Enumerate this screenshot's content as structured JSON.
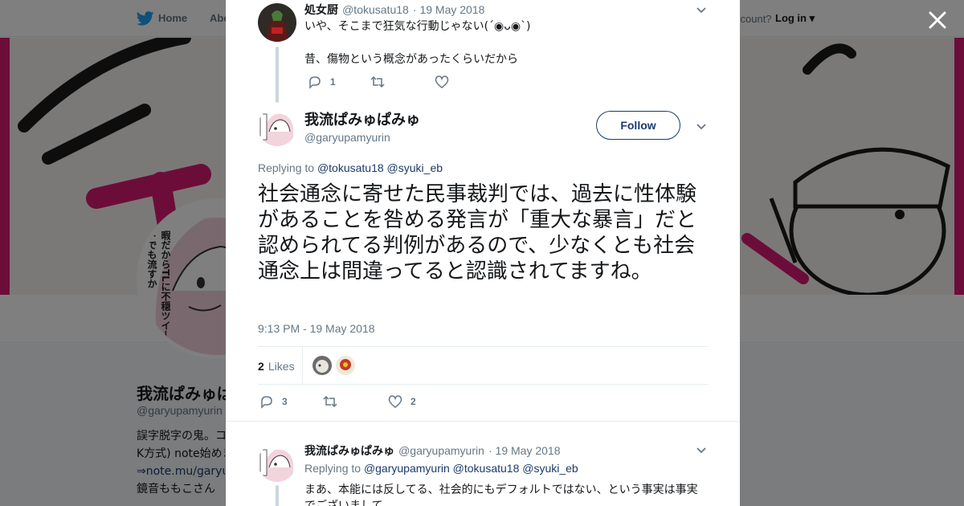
{
  "nav": {
    "home_label": "Home",
    "about_label": "Abo",
    "account_text": "ccount?",
    "login_label": "Log in"
  },
  "profile": {
    "name": "我流ぱみゅぱ",
    "handle": "@garyupamyurin",
    "bio_lines": [
      "誤字脱字の鬼。コ",
      "K方式) note始めま",
      "⇒note.mu/garyup",
      "鏡音ももこさん"
    ],
    "avatar_caption": "暇だからTLに不穏ツイートでも流すか",
    "brand_color": "#d81b72"
  },
  "tweet1": {
    "name": "処女厨",
    "handle": "@tokusatu18",
    "date": "· 19 May 2018",
    "line1": "いや、そこまで狂気な行動じゃない(´◉ᴗ◉`)",
    "line2": "昔、傷物という概念があったくらいだから",
    "reply_count": "1"
  },
  "tweet_main": {
    "name": "我流ぱみゅぱみゅ",
    "handle": "@garyupamyurin",
    "follow_label": "Follow",
    "replying_label": "Replying to",
    "replying_to": [
      "@tokusatu18",
      "@syuki_eb"
    ],
    "text": "社会通念に寄せた民事裁判では、過去に性体験があることを咎める発言が「重大な暴言」だと認められてる判例があるので、少なくとも社会通念上は間違ってると認識されてますね。",
    "timestamp": "9:13 PM - 19 May 2018",
    "likes_count": "2",
    "likes_label": "Likes",
    "reply_count": "3",
    "like_count": "2"
  },
  "tweet3": {
    "name": "我流ぱみゅぱみゅ",
    "handle": "@garyupamyurin",
    "date": "· 19 May 2018",
    "replying_label": "Replying to",
    "replying_to": [
      "@garyupamyurin",
      "@tokusatu18",
      "@syuki_eb"
    ],
    "line1": "まあ、本能には反してる、社会的にもデフォルトではない、という事実は事実",
    "line2": "でございまして"
  },
  "colors": {
    "link": "#1b3a6b",
    "muted": "#657786",
    "text": "#14171a"
  }
}
